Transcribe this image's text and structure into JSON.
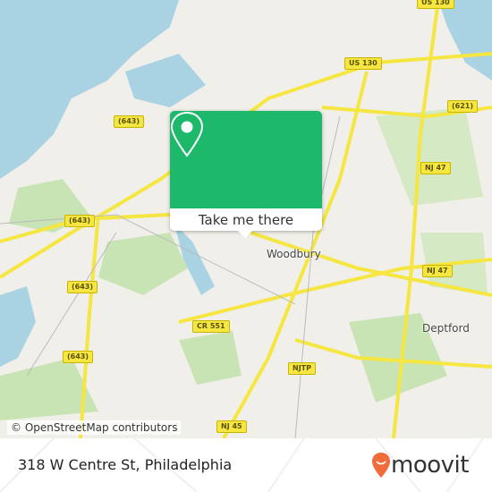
{
  "map": {
    "attribution": "© OpenStreetMap contributors",
    "places": [
      "Woodbury",
      "Deptford"
    ],
    "road_shields": [
      "US 130",
      "US 130",
      "(643)",
      "(643)",
      "(643)",
      "(643)",
      "(621)",
      "NJ 47",
      "NJ 47",
      "CR 551",
      "NJTP",
      "NJ 45"
    ],
    "colors": {
      "land": "#f1efe9",
      "water": "#a9d3e3",
      "park": "#c8e3b4",
      "road": "#f5e642"
    }
  },
  "popup": {
    "button_label": "Take me there",
    "icon": "map-pin-icon",
    "color": "#1db86a"
  },
  "footer": {
    "address": "318 W Centre St, Philadelphia",
    "brand": "moovit",
    "brand_color": "#f26b3a"
  }
}
